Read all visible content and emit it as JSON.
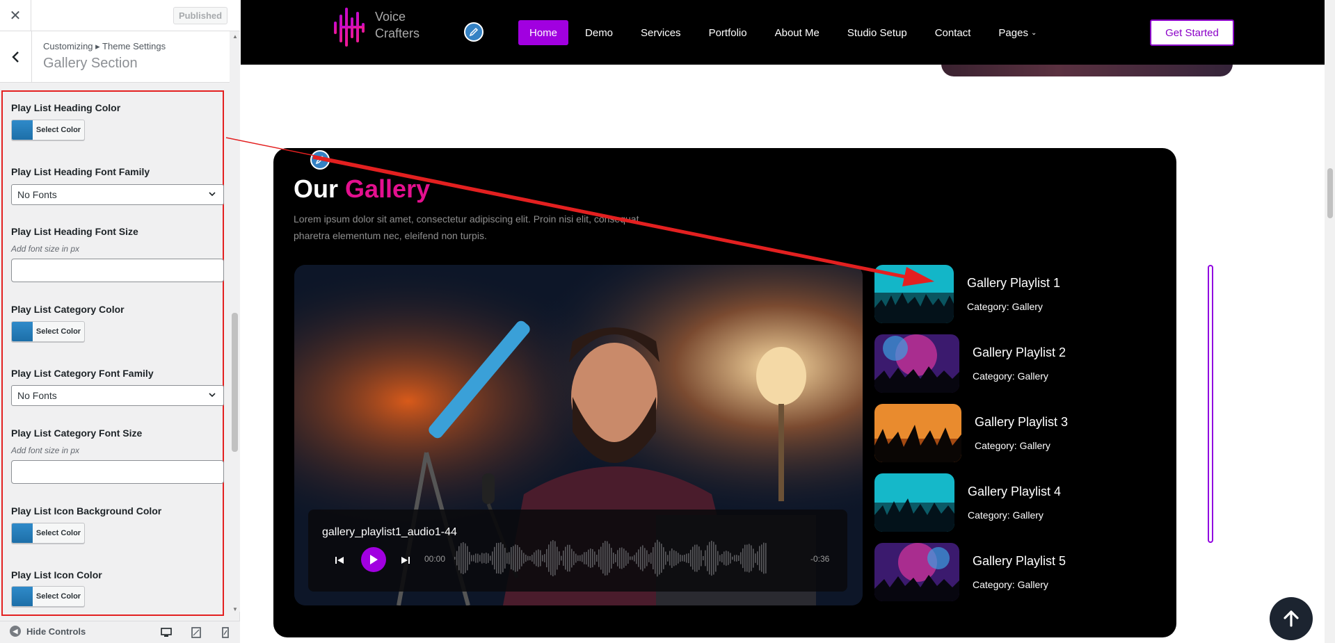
{
  "panel": {
    "close_icon": "close-icon",
    "published_label": "Published",
    "breadcrumb": "Customizing ▸ Theme Settings",
    "section_title": "Gallery Section",
    "controls": [
      {
        "label": "Play List Heading Color",
        "type": "color",
        "button": "Select Color"
      },
      {
        "label": "Play List Heading Font Family",
        "type": "select",
        "value": "No Fonts"
      },
      {
        "label": "Play List Heading Font Size",
        "type": "text",
        "description": "Add font size in px",
        "value": ""
      },
      {
        "label": "Play List Category Color",
        "type": "color",
        "button": "Select Color"
      },
      {
        "label": "Play List Category Font Family",
        "type": "select",
        "value": "No Fonts"
      },
      {
        "label": "Play List Category Font Size",
        "type": "text",
        "description": "Add font size in px",
        "value": ""
      },
      {
        "label": "Play List Icon Background Color",
        "type": "color",
        "button": "Select Color"
      },
      {
        "label": "Play List Icon Color",
        "type": "color",
        "button": "Select Color"
      }
    ],
    "footer": {
      "hide_controls": "Hide Controls"
    }
  },
  "site": {
    "logo_text_line1": "Voice",
    "logo_text_line2": "Crafters",
    "nav": [
      {
        "label": "Home",
        "active": true
      },
      {
        "label": "Demo"
      },
      {
        "label": "Services"
      },
      {
        "label": "Portfolio"
      },
      {
        "label": "About Me"
      },
      {
        "label": "Studio Setup"
      },
      {
        "label": "Contact"
      },
      {
        "label": "Pages",
        "dropdown": true
      }
    ],
    "cta": "Get Started"
  },
  "gallery": {
    "heading_part1": "Our",
    "heading_part2": "Gallery",
    "description": "Lorem ipsum dolor sit amet, consectetur adipiscing elit. Proin nisi elit, consequat pharetra elementum nec, eleifend non turpis.",
    "player": {
      "track": "gallery_playlist1_audio1-44",
      "current_time": "00:00",
      "remaining_time": "-0:36"
    },
    "playlists": [
      {
        "title": "Gallery Playlist 1",
        "category": "Category: Gallery"
      },
      {
        "title": "Gallery Playlist 2",
        "category": "Category: Gallery"
      },
      {
        "title": "Gallery Playlist 3",
        "category": "Category: Gallery"
      },
      {
        "title": "Gallery Playlist 4",
        "category": "Category: Gallery"
      },
      {
        "title": "Gallery Playlist 5",
        "category": "Category: Gallery"
      }
    ]
  },
  "colors": {
    "accent_purple": "#a100e0",
    "accent_pink": "#e4108f",
    "highlight_red": "#e32020",
    "wp_blue": "#3582c4"
  }
}
